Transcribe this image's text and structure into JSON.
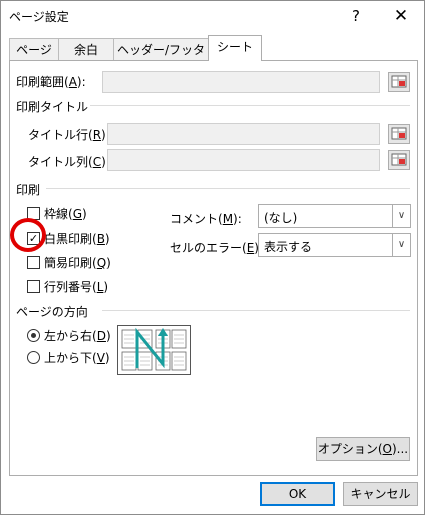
{
  "window": {
    "title": "ページ設定",
    "help": "?",
    "close": "✕"
  },
  "tabs": [
    {
      "label": "ページ"
    },
    {
      "label": "余白"
    },
    {
      "label": "ヘッダー/フッター"
    },
    {
      "label": "シート"
    }
  ],
  "print_area": {
    "label": "印刷範囲(",
    "key": "A",
    "suffix": "):",
    "value": ""
  },
  "print_titles": {
    "heading": "印刷タイトル",
    "rows": {
      "label": "タイトル行(",
      "key": "R",
      "suffix": "):",
      "value": ""
    },
    "cols": {
      "label": "タイトル列(",
      "key": "C",
      "suffix": "):",
      "value": ""
    }
  },
  "print": {
    "heading": "印刷",
    "gridlines": {
      "label": "枠線(",
      "key": "G",
      "suffix": ")",
      "checked": false
    },
    "bw": {
      "label": "白黒印刷(",
      "key": "B",
      "suffix": ")",
      "checked": true,
      "check_glyph": "✓"
    },
    "draft": {
      "label": "簡易印刷(",
      "key": "Q",
      "suffix": ")",
      "checked": false
    },
    "headings": {
      "label": "行列番号(",
      "key": "L",
      "suffix": ")",
      "checked": false
    },
    "comments": {
      "label": "コメント(",
      "key": "M",
      "suffix": "):",
      "value": "(なし)"
    },
    "errors": {
      "label": "セルのエラー(",
      "key": "E",
      "suffix": "):",
      "value": "表示する"
    }
  },
  "page_order": {
    "heading": "ページの方向",
    "over_then_down": {
      "label": "左から右(",
      "key": "D",
      "suffix": ")",
      "selected": true
    },
    "down_then_over": {
      "label": "上から下(",
      "key": "V",
      "suffix": ")",
      "selected": false
    }
  },
  "buttons": {
    "options": {
      "label": "オプション(",
      "key": "O",
      "suffix": ")..."
    },
    "ok": "OK",
    "cancel": "キャンセル"
  },
  "colors": {
    "annotation_circle": "#e00000",
    "focus": "#0078d7",
    "arrow": "#1a9e9e"
  }
}
